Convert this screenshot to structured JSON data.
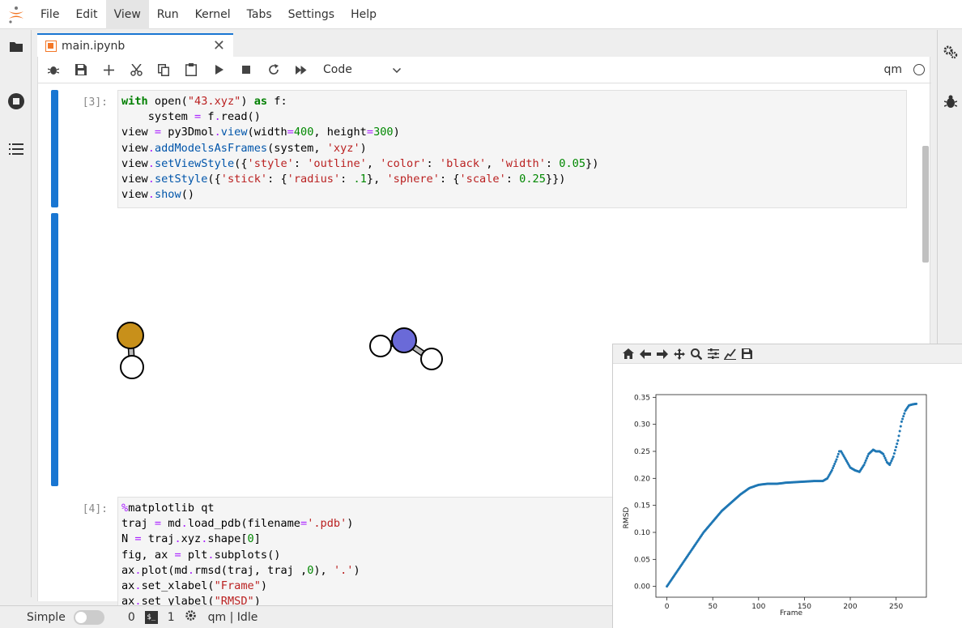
{
  "menubar": {
    "items": [
      "File",
      "Edit",
      "View",
      "Run",
      "Kernel",
      "Tabs",
      "Settings",
      "Help"
    ],
    "active": "View"
  },
  "tab": {
    "title": "main.ipynb",
    "close": "✕"
  },
  "toolbar": {
    "cell_type": "Code",
    "kernel": "qm"
  },
  "cells": [
    {
      "prompt": "[3]:",
      "lines": [
        "with open(\"43.xyz\") as f:",
        "    system = f.read()",
        "view = py3Dmol.view(width=400, height=300)",
        "view.addModelsAsFrames(system, 'xyz')",
        "view.setViewStyle({'style': 'outline', 'color': 'black', 'width': 0.05})",
        "view.setStyle({'stick': {'radius': .1}, 'sphere': {'scale': 0.25}})",
        "view.show()"
      ]
    },
    {
      "prompt": "[4]:",
      "lines": [
        "%matplotlib qt",
        "traj = md.load_pdb(filename='.pdb')",
        "N = traj.xyz.shape[0]",
        "fig, ax = plt.subplots()",
        "ax.plot(md.rmsd(traj, traj ,0), '.')",
        "ax.set_xlabel(\"Frame\")",
        "ax.set_ylabel(\"RMSD\")"
      ]
    }
  ],
  "statusbar": {
    "mode": "Simple",
    "count_a": "0",
    "count_b": "1",
    "kernel_status": "qm | Idle"
  },
  "molecule_colors": {
    "sulfur": "#c8901a",
    "nitrogen": "#6a6ad8",
    "hydrogen": "#ffffff"
  },
  "chart_data": {
    "type": "scatter",
    "xlabel": "Frame",
    "ylabel": "RMSD",
    "xlim": [
      -12,
      283
    ],
    "ylim": [
      -0.02,
      0.355
    ],
    "xticks": [
      0,
      50,
      100,
      150,
      200,
      250
    ],
    "yticks": [
      0.0,
      0.05,
      0.1,
      0.15,
      0.2,
      0.25,
      0.3,
      0.35
    ],
    "ytick_labels": [
      "0.00",
      "0.05",
      "0.10",
      "0.15",
      "0.20",
      "0.25",
      "0.30",
      "0.35"
    ],
    "color": "#1f77b4",
    "series": [
      {
        "x": [
          0,
          10,
          20,
          30,
          40,
          50,
          60,
          70,
          80,
          90,
          100,
          110,
          120,
          130,
          140,
          150,
          160,
          170,
          175,
          180,
          185,
          188,
          190,
          195,
          200,
          205,
          210,
          215,
          220,
          225,
          228,
          232,
          236,
          240,
          243,
          247,
          252,
          256,
          260,
          264,
          268,
          272
        ],
        "y": [
          0.0,
          0.025,
          0.05,
          0.075,
          0.1,
          0.12,
          0.14,
          0.155,
          0.17,
          0.182,
          0.188,
          0.19,
          0.19,
          0.192,
          0.193,
          0.194,
          0.195,
          0.195,
          0.2,
          0.215,
          0.235,
          0.25,
          0.25,
          0.235,
          0.22,
          0.215,
          0.212,
          0.225,
          0.245,
          0.253,
          0.25,
          0.25,
          0.245,
          0.23,
          0.225,
          0.24,
          0.27,
          0.305,
          0.325,
          0.335,
          0.337,
          0.338
        ]
      }
    ]
  }
}
